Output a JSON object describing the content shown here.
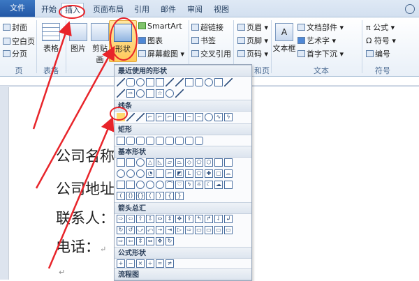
{
  "tabs": {
    "file": "文件",
    "start": "开始",
    "insert": "插入",
    "layout": "页面布局",
    "reference": "引用",
    "mail": "邮件",
    "review": "审阅",
    "view": "视图"
  },
  "ribbon": {
    "pages": {
      "cover": "封面",
      "blank": "空白页",
      "break": "分页",
      "label": "页"
    },
    "table": {
      "button": "表格",
      "label": "表格"
    },
    "illustrations": {
      "picture": "图片",
      "clipart": "剪贴画",
      "shapes": "形状",
      "smartart": "SmartArt",
      "chart": "图表",
      "screenshot": "屏幕截图"
    },
    "links": {
      "hyperlink": "超链接",
      "bookmark": "书签",
      "crossref": "交叉引用"
    },
    "header_footer": {
      "header": "页眉",
      "footer": "页脚",
      "page_number": "页码",
      "label": "和页脚"
    },
    "text": {
      "textbox": "文本框",
      "docparts": "文档部件",
      "wordart": "艺术字",
      "dropcap": "首字下沉",
      "label": "文本"
    },
    "symbols": {
      "equation": "公式",
      "symbol": "符号",
      "number": "编号",
      "label": "符号"
    }
  },
  "dropdown": {
    "recent": "最近使用的形状",
    "lines": "线条",
    "rect": "矩形",
    "basic": "基本形状",
    "arrows": "箭头总汇",
    "equation": "公式形状",
    "flowchart": "流程图"
  },
  "document": {
    "line1": "公司名称：",
    "line2": "公司地址：",
    "line3": "联系人：",
    "line4": "电话：",
    "para_mark": "↵"
  },
  "colors": {
    "accent": "#2358a6",
    "highlight": "#ffc95c",
    "annotation": "#e8242a"
  }
}
